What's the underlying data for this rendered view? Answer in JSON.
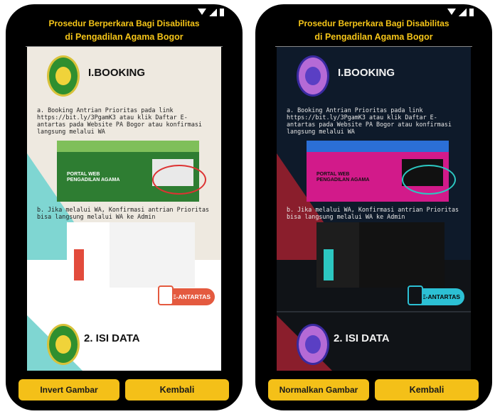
{
  "screen_title": [
    "Prosedur Berperkara Bagi Disabilitas",
    "di Pengadilan Agama Bogor"
  ],
  "section1": {
    "heading": "I.BOOKING",
    "step_a": "a. Booking Antrian Prioritas pada link https://bit.ly/3PgamK3 atau klik Daftar E-antartas pada Website PA Bogor atau konfirmasi langsung melalui WA",
    "screenshot_text": "PORTAL WEB\nPENGADILAN AGAMA",
    "step_b": "b. Jika melalui WA, Konfirmasi antrian Prioritas bisa langsung melalui WA ke Admin",
    "badge": "E-ANTARTAS"
  },
  "section2": {
    "heading": "2. ISI DATA"
  },
  "phones": [
    {
      "mode": "normal",
      "invert_button": "Invert Gambar",
      "back_button": "Kembali"
    },
    {
      "mode": "inverted",
      "invert_button": "Normalkan Gambar",
      "back_button": "Kembali"
    }
  ],
  "colors": {
    "title": "#f5c518",
    "button": "#f4c018",
    "frame": "#000000"
  }
}
